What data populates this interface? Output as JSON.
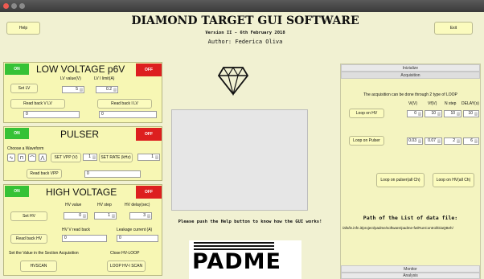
{
  "window": {
    "title": ""
  },
  "header": {
    "title": "DIAMOND TARGET GUI SOFTWARE",
    "version": "Version II - 6th February 2018",
    "author": "Author: Federica Oliva",
    "help_label": "Help",
    "exit_label": "Exit"
  },
  "low_voltage": {
    "title": "LOW VOLTAGE p6V",
    "on_label": "ON",
    "off_label": "OFF",
    "value_label": "LV value(V)",
    "limit_label": "LV I limit(A)",
    "set_label": "Set LV",
    "value": "5",
    "limit": "0.2",
    "read_v_label": "Read back V LV",
    "read_i_label": "Read back I LV",
    "read_v_value": "0",
    "read_i_value": "0"
  },
  "pulser": {
    "title": "PULSER",
    "on_label": "ON",
    "off_label": "OFF",
    "waveform_label": "Choose a Waveform",
    "waveforms": [
      "∿",
      "⊓",
      "⌒",
      "⋀"
    ],
    "set_vpp_label": "SET VPP (V)",
    "vpp": "1",
    "set_rate_label": "SET RATE (kHz)",
    "rate": "1",
    "read_vpp_label": "Read back VPP",
    "read_vpp_value": "0"
  },
  "high_voltage": {
    "title": "HIGH VOLTAGE",
    "on_label": "ON",
    "off_label": "OFF",
    "hv_value_label": "HV value",
    "hv_step_label": "HV step",
    "hv_delay_label": "HV delay(sec)",
    "set_label": "Set HV",
    "hv_value": "0",
    "hv_step": "1",
    "hv_delay": "3",
    "read_hv_label": "Read back HV",
    "hv_v_read_label": "HV V read back",
    "leakage_label": "Leakage current (A)",
    "hv_v_read_value": "0",
    "leakage_value": "0",
    "set_value_note": "Set the Value in the Section Acquisition",
    "close_note": "Close HV-LOOP",
    "hvscan_label": "HVSCAN",
    "loop_scan_label": "LOOP HV-I SCAN"
  },
  "center": {
    "help_hint": "Please push the Help button to know how the GUI works!",
    "logo_text": "PADME"
  },
  "right": {
    "tabs": [
      "Inizialize",
      "Acquisition"
    ],
    "bottom_tabs": [
      "Monitor",
      "Analysis"
    ],
    "acq_note": "The acquisition can be done through 2 type of LOOP",
    "headers": [
      "Vi(V)",
      "Vf(V)",
      "N step",
      "DELAY(s)"
    ],
    "loop_hv_label": "Loop on HV",
    "loop_hv_values": [
      "0",
      "10",
      "10",
      "10"
    ],
    "loop_pulser_label": "Loop on Pulser",
    "loop_pulser_values": [
      "0.03",
      "0.07",
      "2",
      "6"
    ],
    "loop_pulser_all_label": "Loop on pulser(all Ch)",
    "loop_hv_all_label": "Loop on HV(all Ch)",
    "path_title": "Path of the List of data file:",
    "path_value": "/afs/le.infn.it/project/padme/software/padme-fw/RunControl/DiaQBeh/"
  }
}
